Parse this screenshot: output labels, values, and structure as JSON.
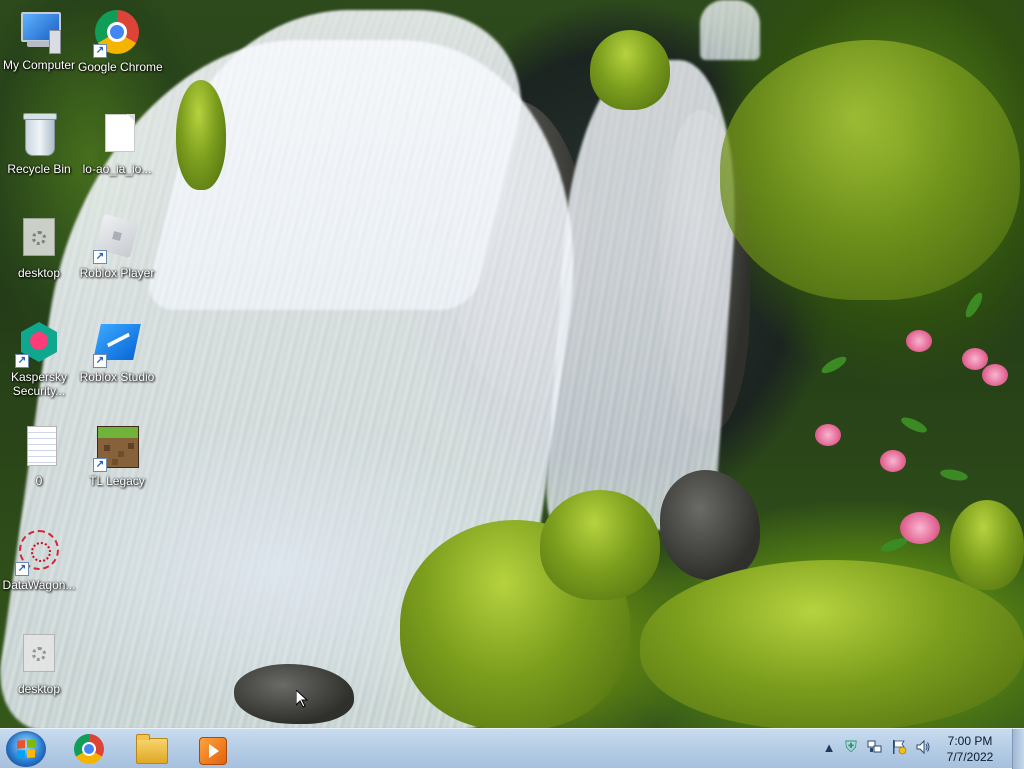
{
  "desktop": {
    "icons": [
      {
        "label": "My Computer",
        "icon": "computer-icon"
      },
      {
        "label": "Google Chrome",
        "icon": "chrome-icon"
      },
      {
        "label": "Recycle Bin",
        "icon": "recycle-bin-icon"
      },
      {
        "label": "lo-ao_ia_io...",
        "icon": "blank-file-icon"
      },
      {
        "label": "desktop",
        "icon": "settings-file-icon"
      },
      {
        "label": "Roblox Player",
        "icon": "roblox-player-icon"
      },
      {
        "label": "Kaspersky Security...",
        "icon": "kaspersky-icon"
      },
      {
        "label": "Roblox Studio",
        "icon": "roblox-studio-icon"
      },
      {
        "label": "0",
        "icon": "text-file-icon"
      },
      {
        "label": "TL Legacy",
        "icon": "tl-legacy-icon"
      },
      {
        "label": "DataWagon...",
        "icon": "datawagon-icon"
      },
      {
        "label": "desktop",
        "icon": "settings-file-icon"
      }
    ]
  },
  "taskbar": {
    "start": {
      "icon": "windows-start-icon"
    },
    "pinned": [
      {
        "name": "Google Chrome",
        "icon": "chrome-icon"
      },
      {
        "name": "Windows Explorer",
        "icon": "folder-icon"
      },
      {
        "name": "Media Player",
        "icon": "media-player-icon"
      }
    ],
    "tray": {
      "icons": [
        "show-hidden-icons-arrow",
        "security-shield-icon",
        "network-icon",
        "action-center-flag-icon",
        "volume-icon"
      ],
      "time": "7:00 PM",
      "date": "7/7/2022"
    }
  },
  "colors": {
    "taskbar_top": "#c9dcef",
    "taskbar_bottom": "#a6c0dd",
    "icon_label_text": "#ffffff",
    "clock_text": "#0c1a2d"
  }
}
